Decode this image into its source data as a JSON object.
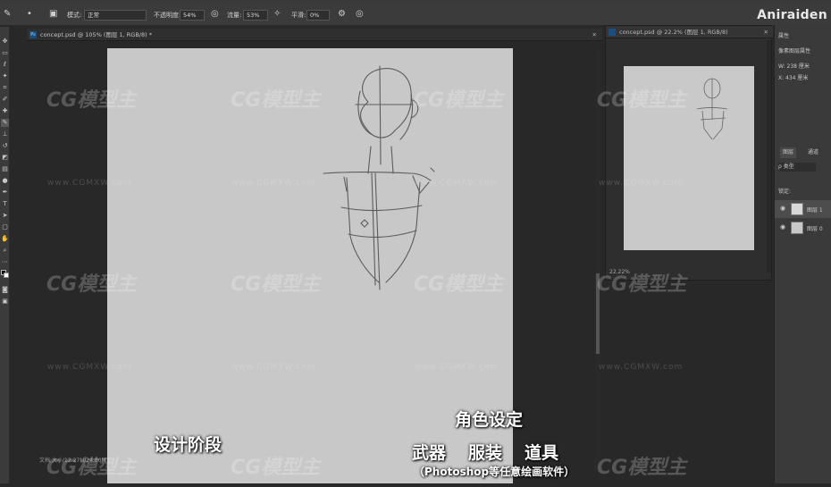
{
  "options_bar": {
    "mode_label": "模式:",
    "mode_value": "正常",
    "opacity_label": "不透明度:",
    "opacity_value": "54%",
    "flow_label": "流量:",
    "flow_value": "53%",
    "smooth_label": "平滑:",
    "smooth_value": "0%"
  },
  "brand": "Aniraiden",
  "document": {
    "tab_title": "concept.psd @ 105% (图层 1, RGB/8) *",
    "status": "文档:大小/12.27M/24.80M"
  },
  "navigator": {
    "tab_title": "concept.psd @ 22.2% (图层 1, RGB/8)",
    "zoom": "22.22%"
  },
  "right_panel": {
    "properties_title": "属性",
    "pixel_layer": "像素图层属性",
    "width": "W: 238 厘米",
    "height": "X: 434 厘米",
    "tabs": [
      "图层",
      "通道"
    ],
    "filter": "ρ 类型",
    "lock_label": "锁定:",
    "layers": [
      {
        "name": "图层 1"
      },
      {
        "name": "图层 0"
      }
    ]
  },
  "watermark": {
    "logo_text": "CG模型主",
    "url_text": "www.CGMXW.com"
  },
  "subtitles": {
    "left": "设计阶段",
    "top": "角色设定",
    "items": [
      "武器",
      "服装",
      "道具"
    ],
    "note": "（Photoshop等任意绘画软件）"
  }
}
